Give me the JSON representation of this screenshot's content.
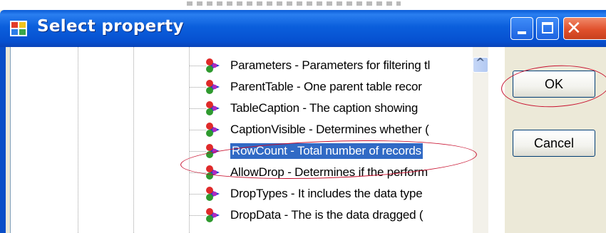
{
  "window": {
    "title": "Select property",
    "icon": "app-grid-icon",
    "controls": [
      "minimize-icon",
      "maximize-icon",
      "close-icon"
    ]
  },
  "tree": {
    "items": [
      {
        "label": "Parameters - Parameters for filtering tl",
        "icon": "property-icon",
        "selected": false
      },
      {
        "label": "ParentTable - One parent table recor",
        "icon": "property-icon",
        "selected": false
      },
      {
        "label": "TableCaption - The caption showing",
        "icon": "property-icon",
        "selected": false
      },
      {
        "label": "CaptionVisible - Determines whether (",
        "icon": "property-icon",
        "selected": false
      },
      {
        "label": "RowCount - Total number of records",
        "icon": "property-icon",
        "selected": true
      },
      {
        "label": "AllowDrop - Determines if the perform",
        "icon": "property-icon",
        "selected": false
      },
      {
        "label": "DropTypes - It includes the data type",
        "icon": "property-icon",
        "selected": false
      },
      {
        "label": "DropData - The is the data dragged (",
        "icon": "property-icon",
        "selected": false
      }
    ]
  },
  "buttons": {
    "ok": "OK",
    "cancel": "Cancel"
  },
  "colors": {
    "titlebar": "#0b5fdc",
    "selection": "#316ac5",
    "annotation": "#c8102e"
  }
}
